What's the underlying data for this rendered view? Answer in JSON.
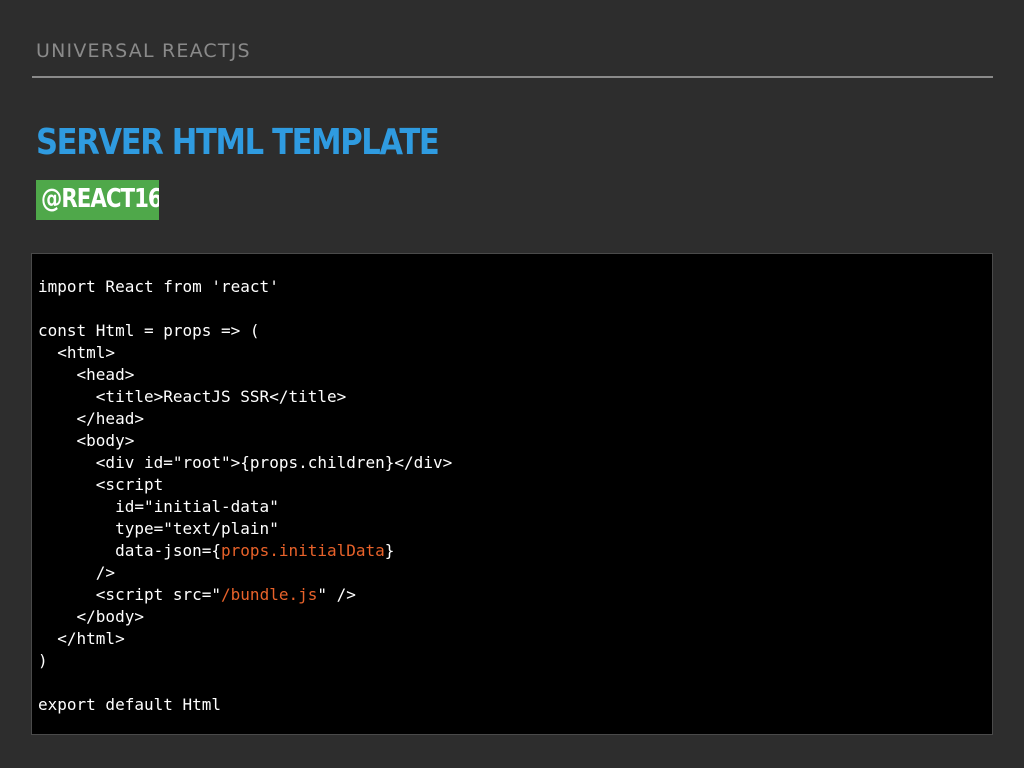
{
  "header": {
    "section": "UNIVERSAL REACTJS",
    "title": "SERVER HTML TEMPLATE",
    "tag": "@REACT16"
  },
  "code": {
    "lines": [
      "import React from 'react'",
      "",
      "const Html = props => (",
      "  <html>",
      "    <head>",
      "      <title>ReactJS SSR</title>",
      "    </head>",
      "    <body>",
      "      <div id=\"root\">{props.children}</div>",
      "      <script",
      "        id=\"initial-data\"",
      "        type=\"text/plain\"",
      "        data-json={",
      "props.initialData",
      "}",
      "      />",
      "      <script src=\"",
      "/bundle.js",
      "\" />",
      "    </body>",
      "  </html>",
      ")",
      "",
      "export default Html"
    ]
  },
  "colors": {
    "background": "#2d2d2d",
    "section_title": "#8a8a8a",
    "title": "#2f9be0",
    "tag_bg": "#4fa84a",
    "code_bg": "#000000",
    "code_text": "#ffffff",
    "code_highlight": "#e8622a"
  }
}
